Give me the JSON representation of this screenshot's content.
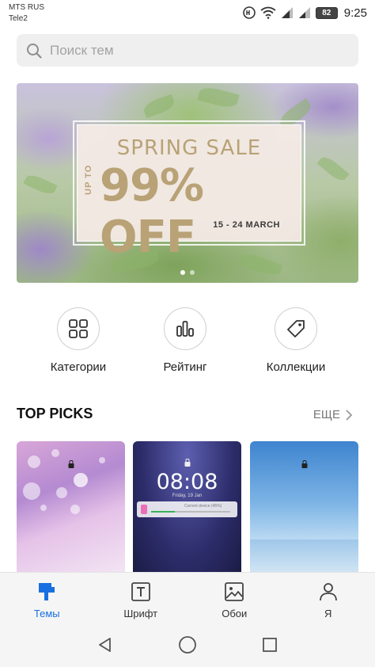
{
  "status_bar": {
    "carrier_1": "MTS RUS",
    "carrier_2": "Tele2",
    "battery": "82",
    "time": "9:25"
  },
  "search": {
    "placeholder": "Поиск тем"
  },
  "banner": {
    "title": "SPRING SALE",
    "up_to": "UP TO",
    "discount": "99% OFF",
    "dates": "15 - 24 MARCH",
    "page_count": 2,
    "active_page": 1
  },
  "shortcuts": [
    {
      "label": "Категории",
      "icon": "grid-icon"
    },
    {
      "label": "Рейтинг",
      "icon": "bar-chart-icon"
    },
    {
      "label": "Коллекции",
      "icon": "tag-icon"
    }
  ],
  "top_picks": {
    "title": "TOP PICKS",
    "more_label": "ЕЩЕ",
    "items": [
      {
        "style": "purple-bokeh"
      },
      {
        "style": "night-sky",
        "clock": "08:08",
        "date": "Friday, 19 Jan",
        "notice": "Current device (45%)"
      },
      {
        "style": "blue-sky"
      }
    ]
  },
  "bottom_nav": [
    {
      "label": "Темы",
      "icon": "brush-icon",
      "active": true
    },
    {
      "label": "Шрифт",
      "icon": "font-icon",
      "active": false
    },
    {
      "label": "Обои",
      "icon": "wallpaper-icon",
      "active": false
    },
    {
      "label": "Я",
      "icon": "person-icon",
      "active": false
    }
  ],
  "colors": {
    "accent": "#1a6fe0",
    "promo_gold": "#b8a276"
  }
}
